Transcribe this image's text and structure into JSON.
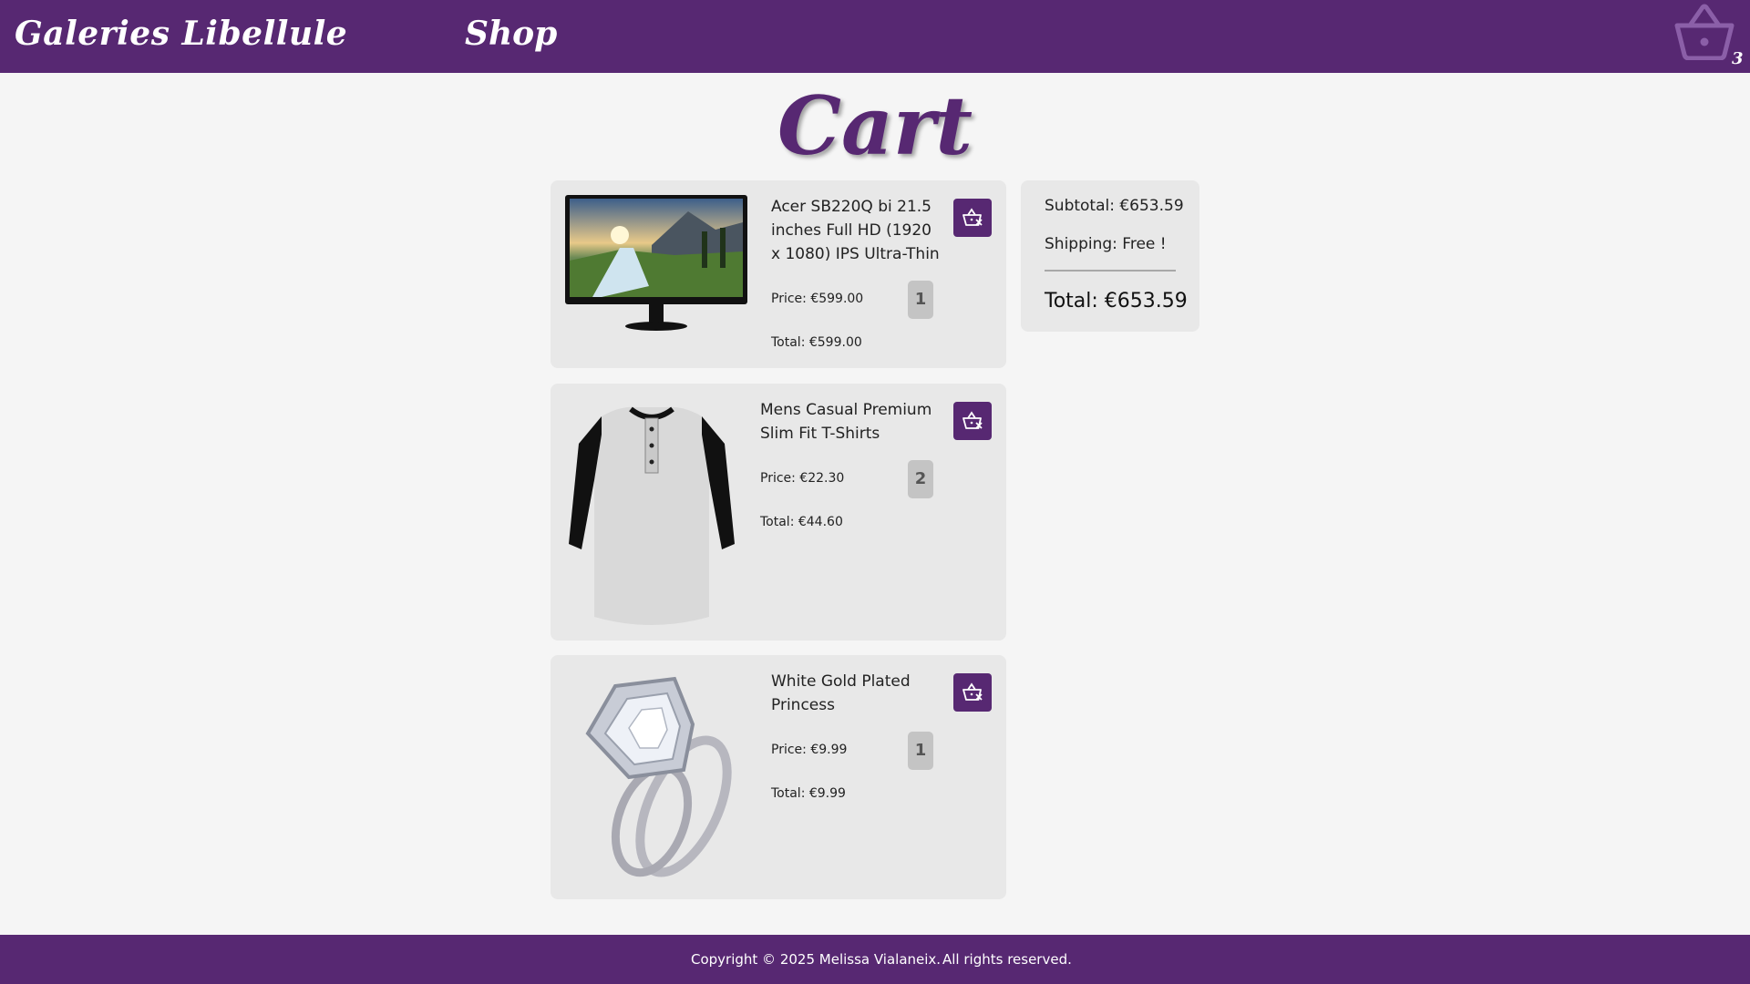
{
  "header": {
    "brand": "Galeries Libellule",
    "nav_shop": "Shop",
    "cart_icon": "shopping-basket-icon",
    "cart_count": "3",
    "background_color": "#572872"
  },
  "page": {
    "title": "Cart",
    "accent_color": "#572872"
  },
  "cart_items": [
    {
      "name": "Acer SB220Q bi 21.5 inches Full HD (1920 x 1080) IPS Ultra-Thin",
      "image": "monitor-product-image",
      "price": "Price: €599.00",
      "quantity": "1",
      "total": "Total: €599.00",
      "remove_icon": "basket-remove-icon"
    },
    {
      "name": "Mens Casual Premium Slim Fit T-Shirts",
      "image": "tshirt-product-image",
      "price": "Price: €22.30",
      "quantity": "2",
      "total": "Total: €44.60",
      "remove_icon": "basket-remove-icon"
    },
    {
      "name": "White Gold Plated Princess",
      "image": "ring-product-image",
      "price": "Price: €9.99",
      "quantity": "1",
      "total": "Total: €9.99",
      "remove_icon": "basket-remove-icon"
    }
  ],
  "summary": {
    "subtotal": "Subtotal: €653.59",
    "shipping": "Shipping: Free !",
    "total": "Total: €653.59"
  },
  "footer": {
    "copyright": "Copyright © 2025 Melissa Vialaneix.",
    "rights": "All rights reserved."
  }
}
